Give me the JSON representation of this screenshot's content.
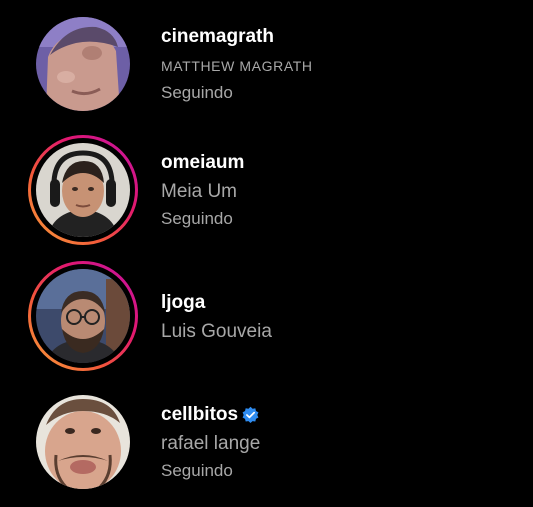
{
  "colors": {
    "background": "#000000",
    "primary_text": "#ffffff",
    "secondary_text": "#a8a8a8",
    "story_ring": [
      "#f9a23a",
      "#f2573a",
      "#e2186f",
      "#c013a8"
    ],
    "verified_badge": "#2f8cf0"
  },
  "accounts": [
    {
      "username": "cinemagrath",
      "full_name": "MATTHEW MAGRATH",
      "status": "Seguindo",
      "has_story_ring": false,
      "verified": false
    },
    {
      "username": "omeiaum",
      "full_name": "Meia Um",
      "status": "Seguindo",
      "has_story_ring": true,
      "verified": false
    },
    {
      "username": "ljoga",
      "full_name": "Luis Gouveia",
      "status": "",
      "has_story_ring": true,
      "verified": false
    },
    {
      "username": "cellbitos",
      "full_name": "rafael lange",
      "status": "Seguindo",
      "has_story_ring": false,
      "verified": true,
      "verified_icon": "verified-badge-icon"
    }
  ]
}
